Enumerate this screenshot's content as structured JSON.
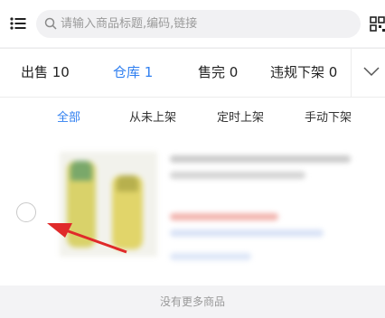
{
  "search": {
    "placeholder": "请输入商品标题,编码,链接"
  },
  "tabs": [
    {
      "label": "出售 10",
      "active": false
    },
    {
      "label": "仓库 1",
      "active": true
    },
    {
      "label": "售完 0",
      "active": false
    },
    {
      "label": "违规下架 0",
      "active": false
    }
  ],
  "subtabs": [
    {
      "label": "全部",
      "active": true
    },
    {
      "label": "从未上架",
      "active": false
    },
    {
      "label": "定时上架",
      "active": false
    },
    {
      "label": "手动下架",
      "active": false
    }
  ],
  "footer": {
    "text": "没有更多商品"
  },
  "colors": {
    "accent": "#2f7ff0",
    "arrow": "#e02a2a"
  },
  "icons": [
    "menu-icon",
    "search-icon",
    "scan-icon",
    "chevron-down-icon"
  ]
}
